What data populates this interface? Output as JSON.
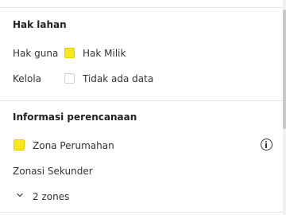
{
  "land_rights": {
    "title": "Hak lahan",
    "rows": [
      {
        "label": "Hak guna",
        "value": "Hak Milik",
        "swatch": "yellow"
      },
      {
        "label": "Kelola",
        "value": "Tidak ada data",
        "swatch": "empty"
      }
    ]
  },
  "planning": {
    "title": "Informasi perencanaan",
    "zone_label": "Zona Perumahan",
    "zone_swatch": "yellow",
    "info_icon": "info-circle-icon",
    "secondary_title": "Zonasi Sekunder",
    "zones_toggle_label": "2 zones",
    "zones_toggle_icon": "chevron-down-icon"
  },
  "colors": {
    "zone_yellow": "#fbe618",
    "divider": "#e4e4e4",
    "text": "#222222"
  }
}
